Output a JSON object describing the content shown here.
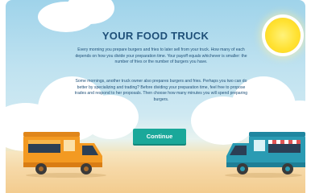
{
  "title": "YOUR FOOD TRUCK",
  "paragraph1": "Every morning you prepare burgers and fries to later sell from your truck. How many of each depends on how you divide your preparation time.  Your payoff equals whichever is smaller: the number of fries or the number of burgers you have.",
  "paragraph2": "Some mornings, another truck owner also prepares burgers and fries. Perhaps you two can do better by specializing and trading? Before dividing your preparation time, feel free to propose trades and respond to her proposals. Then choose how many minutes you will spend preparing burgers.",
  "continue_label": "Continue",
  "colors": {
    "title": "#1e4f78",
    "button": "#1aa89a",
    "left_truck": "#f39a22",
    "right_truck": "#2a9bb3"
  },
  "icons": [
    "sun-icon",
    "cloud-icon",
    "orange-food-truck-icon",
    "teal-food-truck-icon"
  ]
}
